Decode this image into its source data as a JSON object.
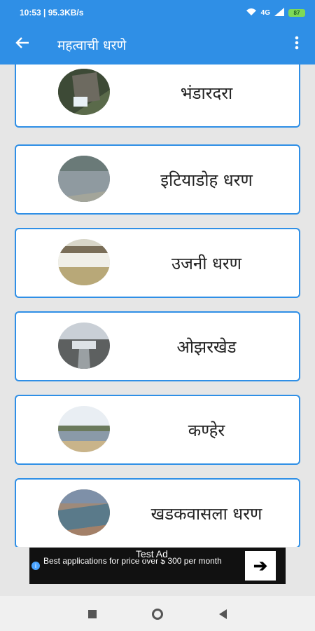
{
  "status": {
    "time_speed": "10:53 | 95.3KB/s",
    "signal": "4G",
    "battery": "87"
  },
  "app_bar": {
    "title": "महत्वाची धरणे"
  },
  "dams": [
    {
      "name": "भंडारदरा"
    },
    {
      "name": "इटियाडोह धरण"
    },
    {
      "name": "उजनी धरण"
    },
    {
      "name": "ओझरखेड"
    },
    {
      "name": "कण्हेर"
    },
    {
      "name": "खडकवासला धरण"
    }
  ],
  "ad": {
    "label": "Test Ad",
    "text": "Best applications for price over $ 300 per month",
    "info": "i",
    "arrow": "➔"
  },
  "colors": {
    "primary": "#2f8fe6",
    "background": "#e6e6e6"
  }
}
